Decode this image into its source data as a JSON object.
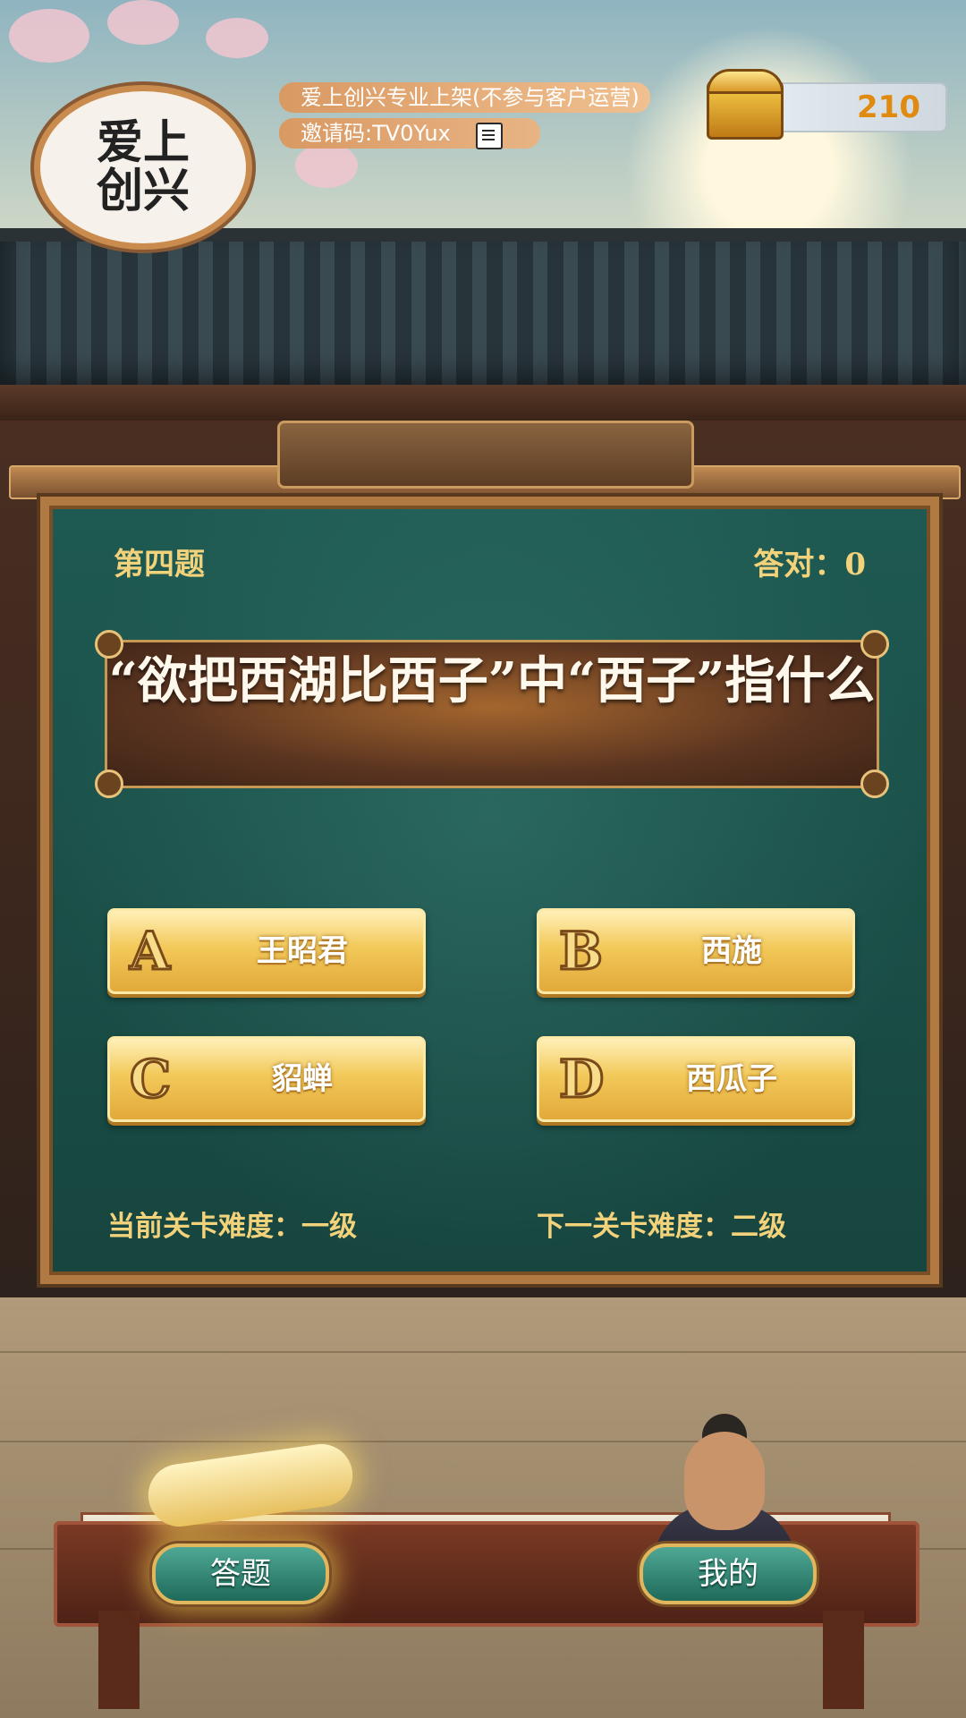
{
  "header": {
    "avatar_text": "爱上\n创兴",
    "user_name": "爱上创兴专业上架(不参与客户运营)",
    "invite_code": "邀请码:TV0Yux",
    "coins": "210"
  },
  "quiz": {
    "question_index": "第四题",
    "score": "答对：0",
    "question": "“欲把西湖比西子”中“西子”指什么",
    "options": [
      {
        "letter": "A",
        "text": "王昭君"
      },
      {
        "letter": "B",
        "text": "西施"
      },
      {
        "letter": "C",
        "text": "貂蝉"
      },
      {
        "letter": "D",
        "text": "西瓜子"
      }
    ],
    "current_level": "当前关卡难度：一级",
    "next_level": "下一关卡难度：二级"
  },
  "bottom_nav": {
    "answer_label": "答题",
    "mine_label": "我的",
    "active": "answer"
  },
  "icons": {
    "copy": "copy-icon",
    "treasure": "treasure-chest-icon",
    "scroll": "scroll-icon",
    "character": "character-avatar"
  },
  "colors": {
    "board": "#1e5a52",
    "gold_text": "#f2d27a",
    "coin_value": "#e08a10",
    "option_gold": "#f2c95a"
  }
}
